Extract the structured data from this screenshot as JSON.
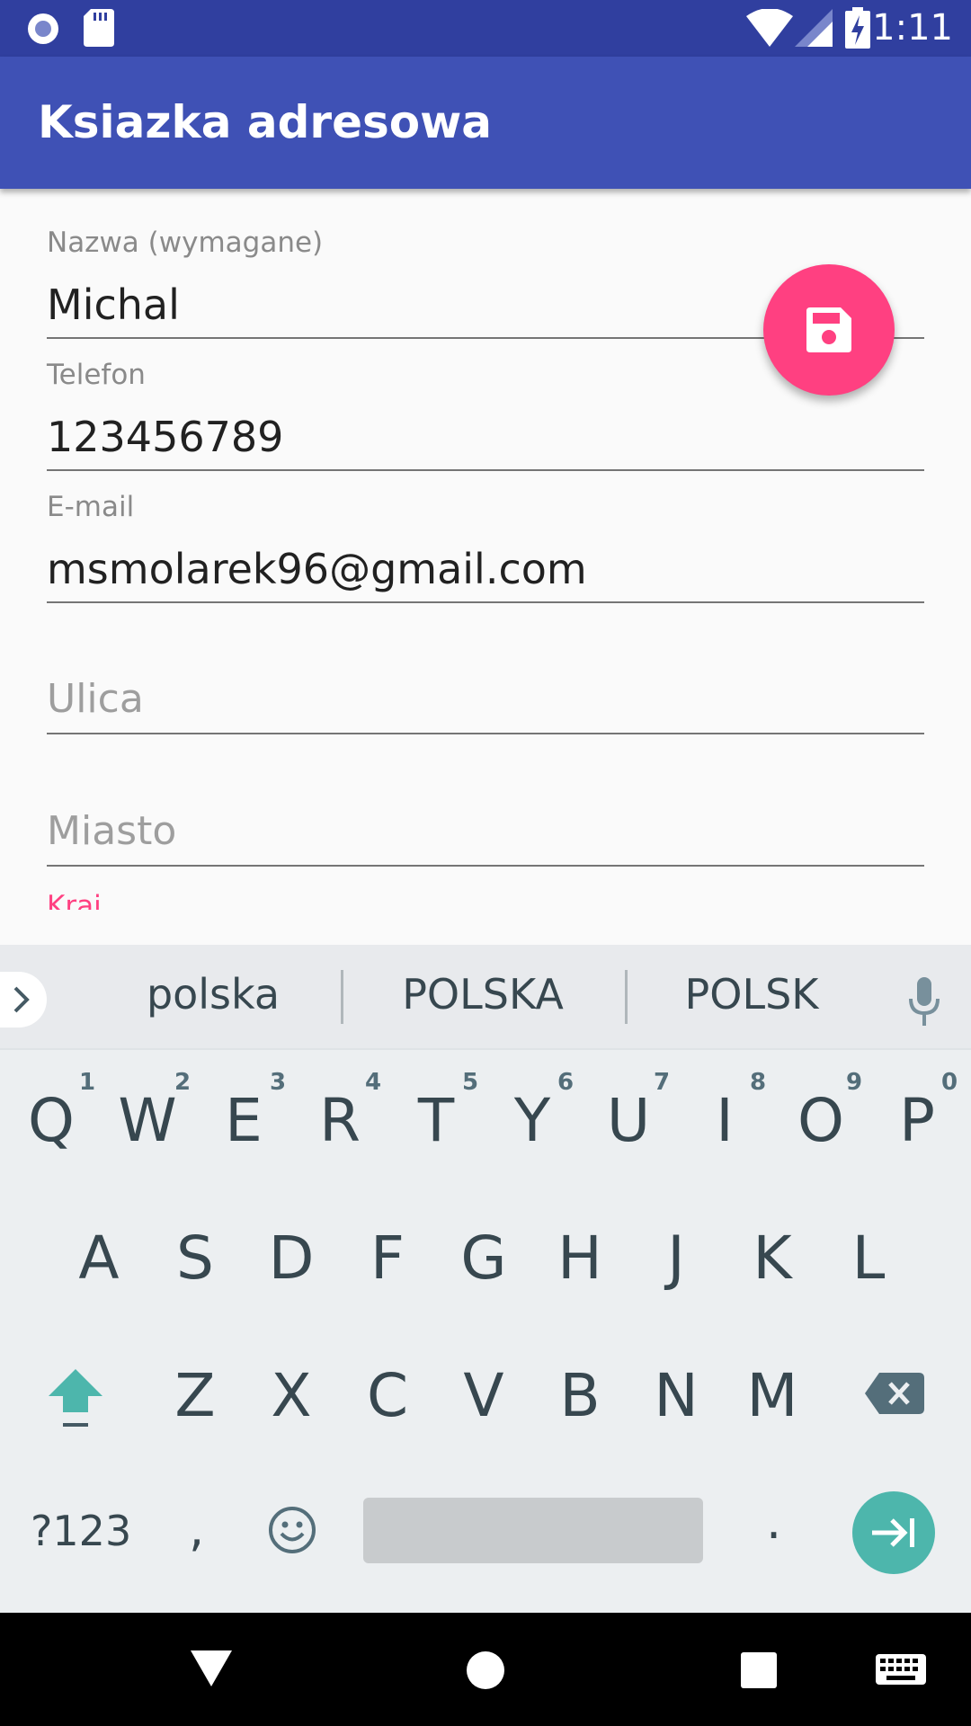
{
  "status_bar": {
    "time": "1:11",
    "icons": [
      "circle-notification-icon",
      "sd-card-icon",
      "wifi-icon",
      "signal-icon",
      "battery-charging-icon"
    ]
  },
  "app_bar": {
    "title": "Ksiazka adresowa"
  },
  "form": {
    "name": {
      "label": "Nazwa (wymagane)",
      "value": "Michal"
    },
    "phone": {
      "label": "Telefon",
      "value": "123456789"
    },
    "email": {
      "label": "E-mail",
      "value": "msmolarek96@gmail.com"
    },
    "street": {
      "placeholder": "Ulica"
    },
    "city": {
      "placeholder": "Miasto"
    },
    "country": {
      "label": "Kraj"
    }
  },
  "fab": {
    "icon": "save-icon",
    "color": "#ff4081"
  },
  "keyboard": {
    "suggestions": [
      "polska",
      "POLSKA",
      "POLSK"
    ],
    "row1": [
      "Q",
      "W",
      "E",
      "R",
      "T",
      "Y",
      "U",
      "I",
      "O",
      "P"
    ],
    "row1_hints": [
      "1",
      "2",
      "3",
      "4",
      "5",
      "6",
      "7",
      "8",
      "9",
      "0"
    ],
    "row2": [
      "A",
      "S",
      "D",
      "F",
      "G",
      "H",
      "J",
      "K",
      "L"
    ],
    "row3": [
      "Z",
      "X",
      "C",
      "V",
      "B",
      "N",
      "M"
    ],
    "bottom": {
      "symbols": "?123",
      "comma": ",",
      "period": "."
    }
  },
  "colors": {
    "primary": "#3f51b5",
    "primary_dark": "#303f9f",
    "accent": "#ff4081",
    "enter": "#4db6ac"
  }
}
